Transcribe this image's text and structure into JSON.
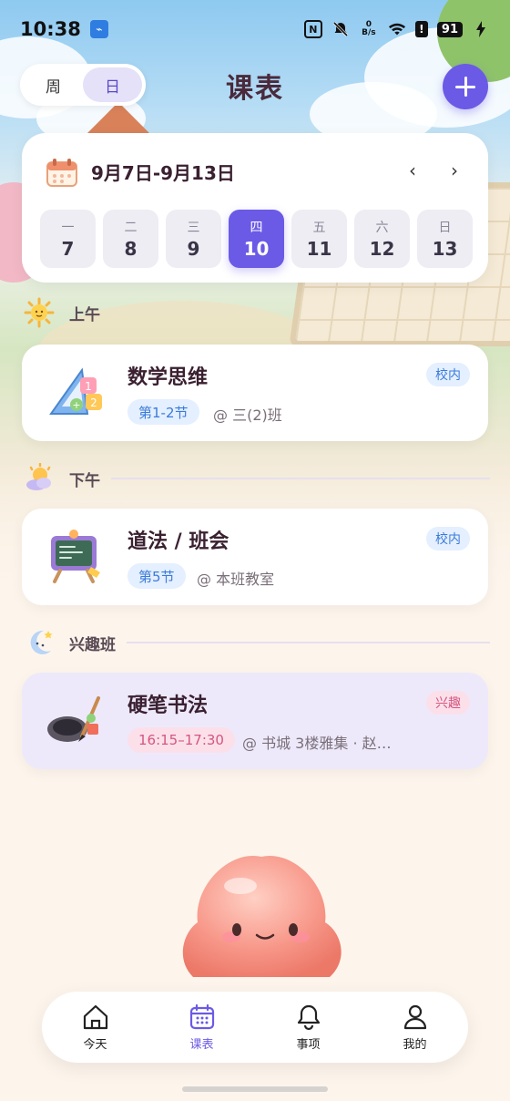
{
  "status_bar": {
    "time": "10:38",
    "net_speed_top": "0",
    "net_speed_unit": "B/s",
    "battery": "91"
  },
  "header": {
    "title": "课表",
    "view_toggle": {
      "week": "周",
      "day": "日",
      "selected": "日"
    }
  },
  "week": {
    "range": "9月7日-9月13日",
    "prev": "‹",
    "next": "›",
    "days": [
      {
        "weekday": "一",
        "date": "7"
      },
      {
        "weekday": "二",
        "date": "8"
      },
      {
        "weekday": "三",
        "date": "9"
      },
      {
        "weekday": "四",
        "date": "10"
      },
      {
        "weekday": "五",
        "date": "11"
      },
      {
        "weekday": "六",
        "date": "12"
      },
      {
        "weekday": "日",
        "date": "13"
      }
    ],
    "selected_index": 3
  },
  "sections": {
    "morning": "上午",
    "afternoon": "下午",
    "interest": "兴趣班"
  },
  "courses": [
    {
      "name": "数学思维",
      "period": "第1-2节",
      "location": "@ 三(2)班",
      "tag": "校内"
    },
    {
      "name": "道法 / 班会",
      "period": "第5节",
      "location": "@ 本班教室",
      "tag": "校内"
    },
    {
      "name": "硬笔书法",
      "period": "16:15–17:30",
      "location": "@ 书城 3楼雅集 · 赵…",
      "tag": "兴趣"
    }
  ],
  "bottom_nav": [
    {
      "label": "今天",
      "icon": "home-icon"
    },
    {
      "label": "课表",
      "icon": "calendar-icon"
    },
    {
      "label": "事项",
      "icon": "bell-icon"
    },
    {
      "label": "我的",
      "icon": "user-icon"
    }
  ],
  "colors": {
    "accent": "#6b5ae6",
    "school_tag": "#3b7bd9",
    "interest_tag": "#d5557f",
    "interest_card": "#ede9fb"
  }
}
